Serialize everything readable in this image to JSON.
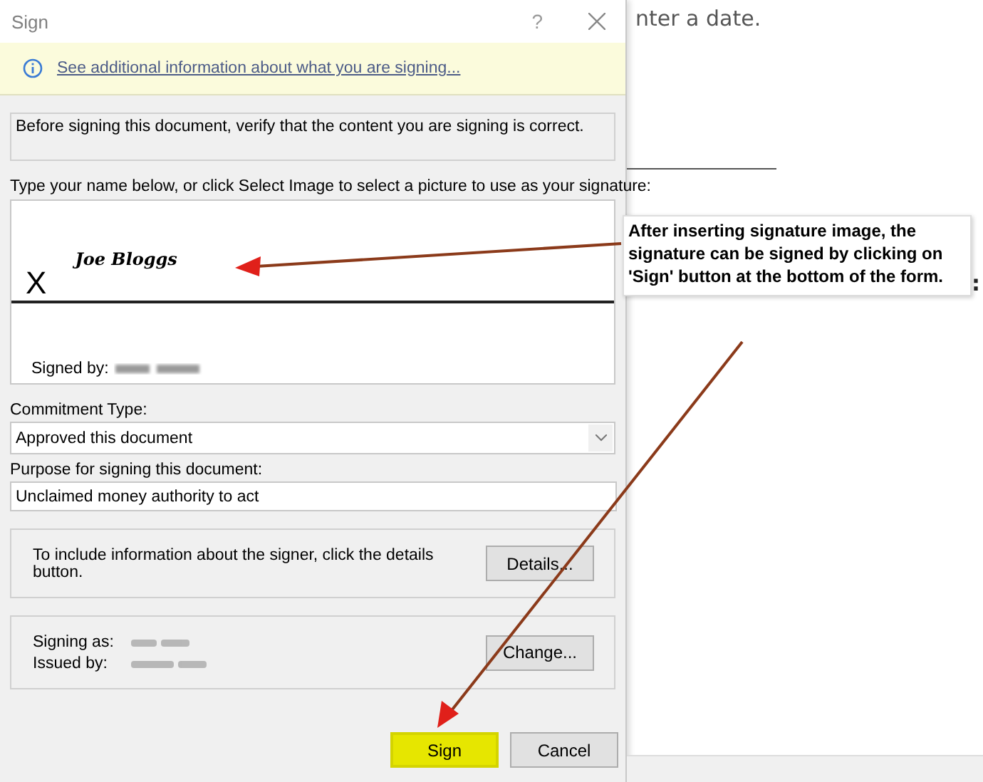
{
  "window": {
    "title": "Sign",
    "help": "?"
  },
  "info_bar": {
    "link": "See additional information about what you are signing..."
  },
  "notice": "Before signing this document, verify that the content you are signing is correct.",
  "signature": {
    "prompt": "Type your name below, or click Select Image to select a picture to use as your signature:",
    "mark": "X",
    "name": "Joe Bloggs",
    "signed_by_label": "Signed by:"
  },
  "commitment": {
    "label": "Commitment Type:",
    "value": "Approved this document"
  },
  "purpose": {
    "label": "Purpose for signing this document:",
    "value": "Unclaimed money authority to act"
  },
  "details": {
    "text": "To include information about the signer, click the details button.",
    "button": "Details..."
  },
  "certificate": {
    "signing_as_label": "Signing as:",
    "issued_by_label": "Issued by:",
    "button": "Change..."
  },
  "buttons": [
    {
      "label": "Sign",
      "highlighted": true
    },
    {
      "label": "Cancel",
      "highlighted": false
    }
  ],
  "background_document": {
    "text": "nter a date.",
    "text_2": ":"
  },
  "callout": {
    "text": "After inserting signature image, the signature can be signed by clicking on 'Sign' button at the bottom of the form."
  }
}
